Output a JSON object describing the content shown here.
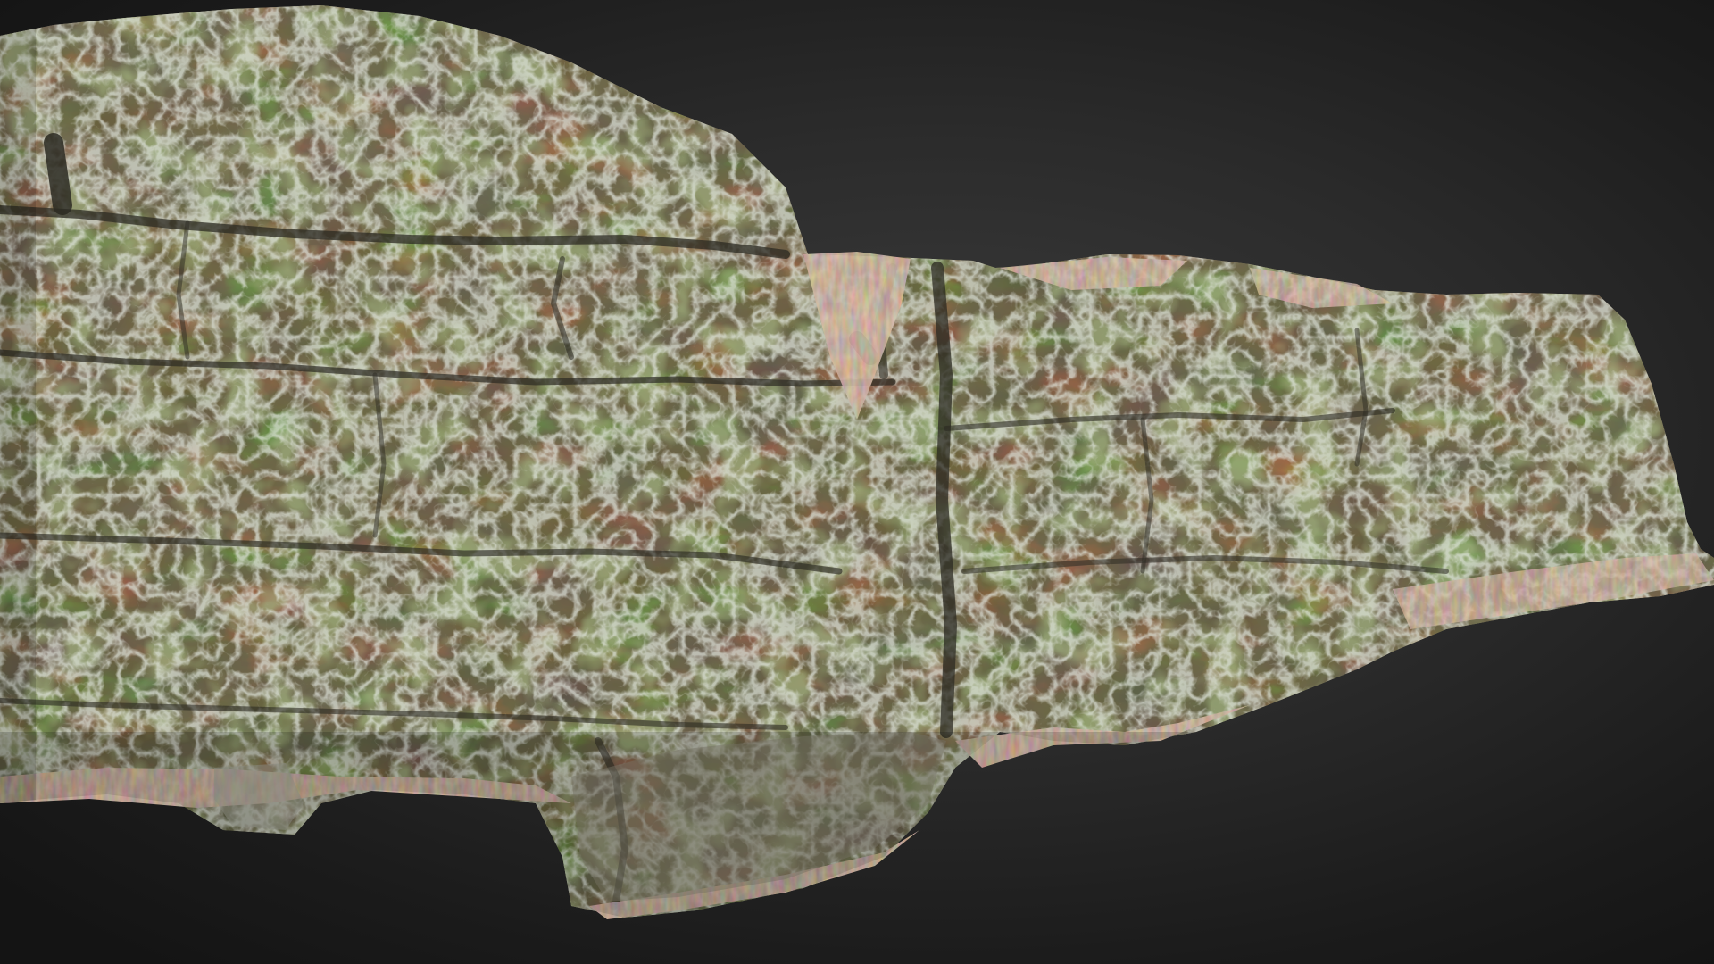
{
  "scene": {
    "subject": "rock-outcrop-scan",
    "background": {
      "center_color": "#3c3c3c",
      "edge_color": "#141414"
    },
    "palette": {
      "rock_base": "#6f6a55",
      "rock_warm": "#8a6a43",
      "rock_light": "#a7a292",
      "lichen": "#b9c0b4",
      "moss": "#5d6b3a",
      "shadow": "#2b2a22",
      "pine_needles": "#7a5a45"
    }
  }
}
